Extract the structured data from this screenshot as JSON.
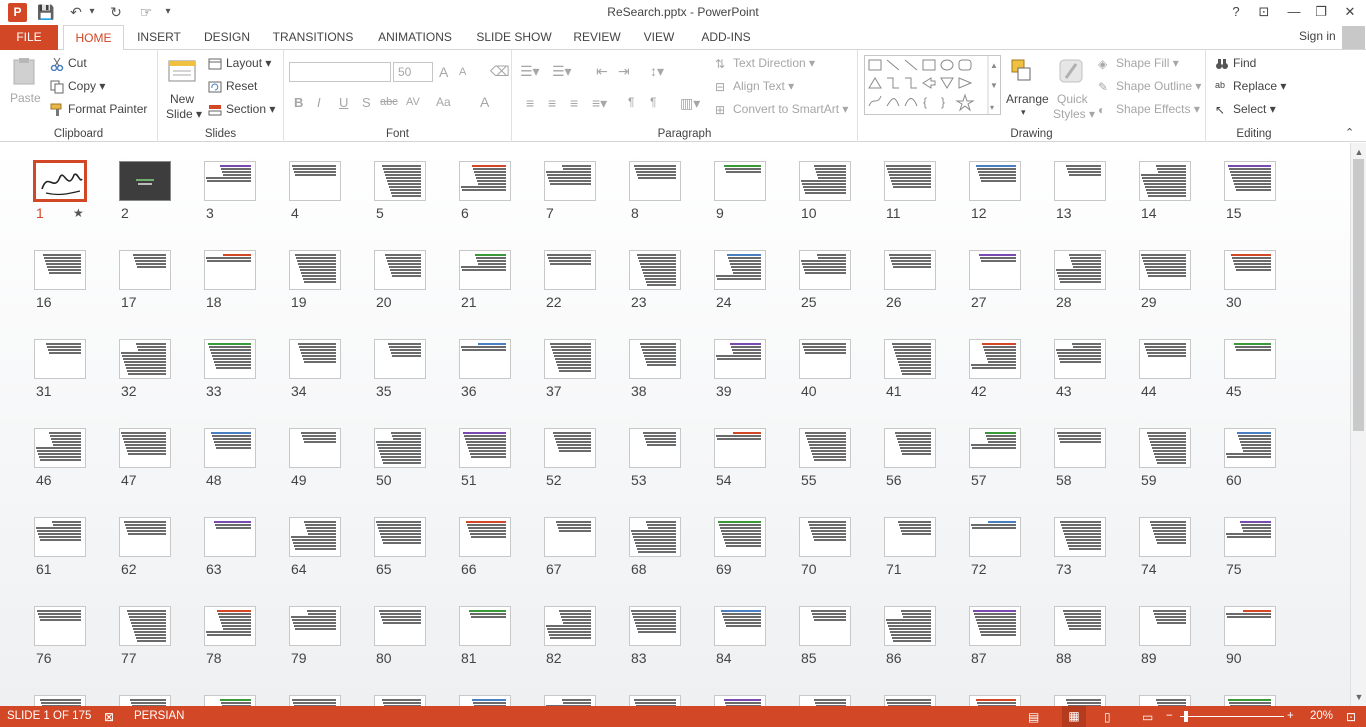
{
  "window": {
    "title": "ReSearch.pptx - PowerPoint",
    "app_icon_letter": "P",
    "help": "?",
    "ribbon_display": "⊡",
    "minimize": "—",
    "maximize": "❐",
    "close": "✕"
  },
  "quick_access": {
    "save": "💾",
    "undo": "↶",
    "redo": "↻",
    "touch": "☞",
    "customize": "▾"
  },
  "tabs": {
    "file": "FILE",
    "items": [
      "HOME",
      "INSERT",
      "DESIGN",
      "TRANSITIONS",
      "ANIMATIONS",
      "SLIDE SHOW",
      "REVIEW",
      "VIEW",
      "ADD-INS"
    ],
    "active": "HOME",
    "signin": "Sign in"
  },
  "ribbon": {
    "clipboard": {
      "label": "Clipboard",
      "paste": "Paste",
      "cut": "Cut",
      "copy": "Copy",
      "format_painter": "Format Painter"
    },
    "slides": {
      "label": "Slides",
      "new_slide_1": "New",
      "new_slide_2": "Slide",
      "layout": "Layout",
      "reset": "Reset",
      "section": "Section"
    },
    "font": {
      "label": "Font",
      "font_name": "",
      "font_size": "50",
      "bold": "B",
      "italic": "I",
      "underline": "U",
      "shadow": "S",
      "strike": "abc",
      "spacing": "AV",
      "case": "Aa",
      "color": "A",
      "grow": "A",
      "shrink": "A"
    },
    "paragraph": {
      "label": "Paragraph",
      "text_direction": "Text Direction",
      "align_text": "Align Text",
      "convert_smartart": "Convert to SmartArt"
    },
    "drawing": {
      "label": "Drawing",
      "arrange": "Arrange",
      "quick_styles_1": "Quick",
      "quick_styles_2": "Styles",
      "shape_fill": "Shape Fill",
      "shape_outline": "Shape Outline",
      "shape_effects": "Shape Effects"
    },
    "editing": {
      "label": "Editing",
      "find": "Find",
      "replace": "Replace",
      "select": "Select"
    }
  },
  "slides": {
    "count": 105,
    "selected": 1,
    "selected_star": "★"
  },
  "status": {
    "slide_info": "SLIDE 1 OF 175",
    "language": "PERSIAN",
    "zoom": "20%"
  },
  "colors": {
    "accent": "#d24726"
  }
}
